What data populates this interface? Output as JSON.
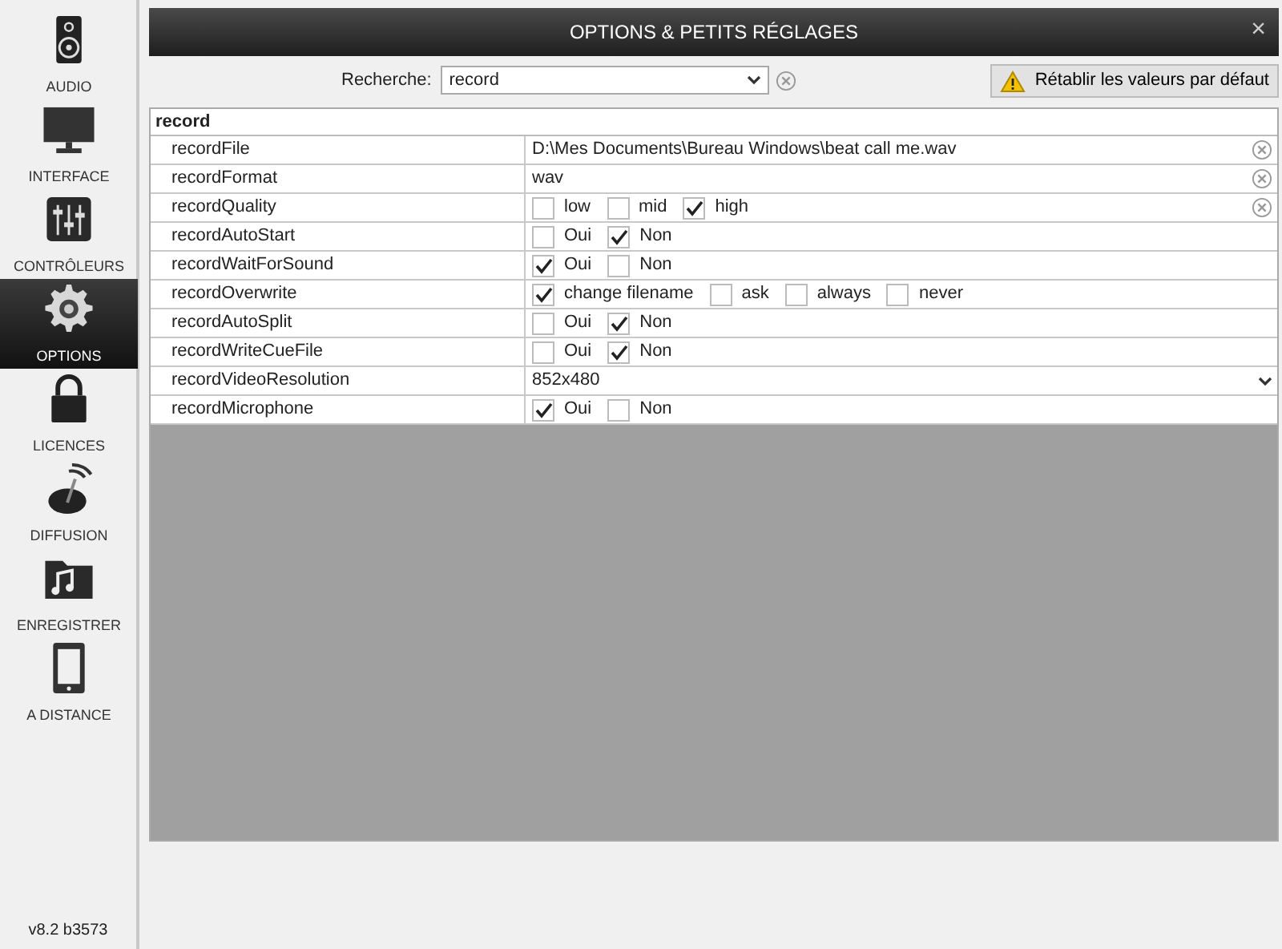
{
  "sidebar": {
    "items": [
      {
        "label": "AUDIO",
        "selected": false
      },
      {
        "label": "INTERFACE",
        "selected": false
      },
      {
        "label": "CONTRÔLEURS",
        "selected": false
      },
      {
        "label": "OPTIONS",
        "selected": true
      },
      {
        "label": "LICENCES",
        "selected": false
      },
      {
        "label": "DIFFUSION",
        "selected": false
      },
      {
        "label": "ENREGISTRER",
        "selected": false
      },
      {
        "label": "A DISTANCE",
        "selected": false
      }
    ],
    "version": "v8.2 b3573"
  },
  "window": {
    "title": "OPTIONS & PETITS RÉGLAGES",
    "close": "×"
  },
  "search": {
    "label": "Recherche:",
    "value": "record"
  },
  "reset_button": "Rétablir les valeurs par défaut",
  "table": {
    "group": "record",
    "rows": [
      {
        "name": "recordFile",
        "kind": "text",
        "value": "D:\\Mes Documents\\Bureau Windows\\beat call me.wav",
        "modified": true
      },
      {
        "name": "recordFormat",
        "kind": "text",
        "value": "wav",
        "modified": true
      },
      {
        "name": "recordQuality",
        "kind": "options",
        "modified": true,
        "options": [
          {
            "label": "low",
            "checked": false
          },
          {
            "label": "mid",
            "checked": false
          },
          {
            "label": "high",
            "checked": true
          }
        ]
      },
      {
        "name": "recordAutoStart",
        "kind": "options",
        "modified": false,
        "options": [
          {
            "label": "Oui",
            "checked": false
          },
          {
            "label": "Non",
            "checked": true
          }
        ]
      },
      {
        "name": "recordWaitForSound",
        "kind": "options",
        "modified": false,
        "options": [
          {
            "label": "Oui",
            "checked": true
          },
          {
            "label": "Non",
            "checked": false
          }
        ]
      },
      {
        "name": "recordOverwrite",
        "kind": "options",
        "modified": false,
        "options": [
          {
            "label": "change filename",
            "checked": true
          },
          {
            "label": "ask",
            "checked": false
          },
          {
            "label": "always",
            "checked": false
          },
          {
            "label": "never",
            "checked": false
          }
        ]
      },
      {
        "name": "recordAutoSplit",
        "kind": "options",
        "modified": false,
        "options": [
          {
            "label": "Oui",
            "checked": false
          },
          {
            "label": "Non",
            "checked": true
          }
        ]
      },
      {
        "name": "recordWriteCueFile",
        "kind": "options",
        "modified": false,
        "options": [
          {
            "label": "Oui",
            "checked": false
          },
          {
            "label": "Non",
            "checked": true
          }
        ]
      },
      {
        "name": "recordVideoResolution",
        "kind": "select",
        "value": "852x480",
        "modified": false
      },
      {
        "name": "recordMicrophone",
        "kind": "options",
        "modified": false,
        "options": [
          {
            "label": "Oui",
            "checked": true
          },
          {
            "label": "Non",
            "checked": false
          }
        ]
      }
    ]
  }
}
